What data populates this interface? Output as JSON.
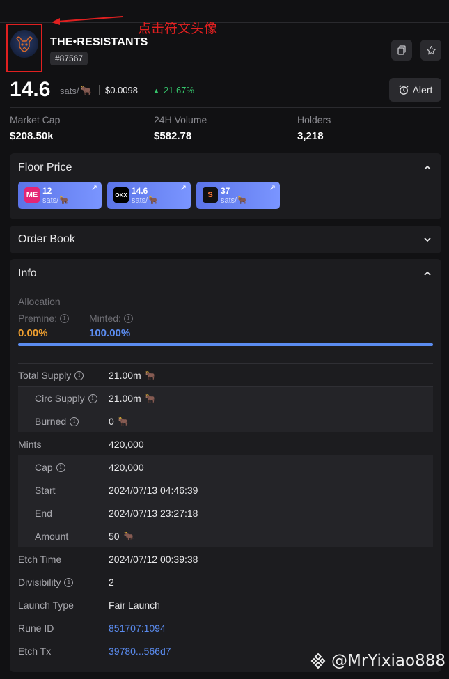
{
  "annotation": {
    "text": "点击符文头像"
  },
  "header": {
    "title": "THE•RESISTANTS",
    "rune_number": "#87567"
  },
  "price": {
    "value": "14.6",
    "unit": "sats/",
    "usd": "$0.0098",
    "change": "21.67%",
    "alert_label": "Alert"
  },
  "stats": [
    {
      "label": "Market Cap",
      "value": "$208.50k"
    },
    {
      "label": "24H Volume",
      "value": "$582.78"
    },
    {
      "label": "Holders",
      "value": "3,218"
    }
  ],
  "floor_price": {
    "title": "Floor Price",
    "markets": [
      {
        "value": "12",
        "unit": "sats/",
        "logo_text": "ME",
        "logo_color": "#e42575"
      },
      {
        "value": "14.6",
        "unit": "sats/",
        "logo_text": "OKX",
        "logo_color": "#000000"
      },
      {
        "value": "37",
        "unit": "sats/",
        "logo_text": "S",
        "logo_color": "#111111"
      }
    ]
  },
  "order_book": {
    "title": "Order Book"
  },
  "info": {
    "title": "Info",
    "allocation_label": "Allocation",
    "premine_label": "Premine:",
    "premine_value": "0.00%",
    "minted_label": "Minted:",
    "minted_value": "100.00%",
    "minted_fraction": 1.0,
    "rows": [
      {
        "key": "Total Supply",
        "value": "21.00m",
        "info": true,
        "rune_icon": true,
        "sub": false
      },
      {
        "key": "Circ Supply",
        "value": "21.00m",
        "info": true,
        "rune_icon": true,
        "sub": true
      },
      {
        "key": "Burned",
        "value": "0",
        "info": true,
        "rune_icon": true,
        "sub": true
      },
      {
        "key": "Mints",
        "value": "420,000",
        "info": false,
        "rune_icon": false,
        "sub": false
      },
      {
        "key": "Cap",
        "value": "420,000",
        "info": true,
        "rune_icon": false,
        "sub": true
      },
      {
        "key": "Start",
        "value": "2024/07/13 04:46:39",
        "info": false,
        "rune_icon": false,
        "sub": true
      },
      {
        "key": "End",
        "value": "2024/07/13 23:27:18",
        "info": false,
        "rune_icon": false,
        "sub": true
      },
      {
        "key": "Amount",
        "value": "50",
        "info": false,
        "rune_icon": true,
        "sub": true
      },
      {
        "key": "Etch Time",
        "value": "2024/07/12 00:39:38",
        "info": false,
        "rune_icon": false,
        "sub": false
      },
      {
        "key": "Divisibility",
        "value": "2",
        "info": true,
        "rune_icon": false,
        "sub": false
      },
      {
        "key": "Launch Type",
        "value": "Fair Launch",
        "info": false,
        "rune_icon": false,
        "sub": false
      },
      {
        "key": "Rune ID",
        "value": "851707:1094",
        "info": false,
        "rune_icon": false,
        "sub": false,
        "link": true
      },
      {
        "key": "Etch Tx",
        "value": "39780...566d7",
        "info": false,
        "rune_icon": false,
        "sub": false,
        "link": true
      }
    ]
  },
  "watermark": {
    "text": "@MrYixiao888"
  },
  "colors": {
    "accent": "#5b8cf0",
    "positive": "#35c46b",
    "premine": "#f0a030",
    "annotation": "#e02020"
  }
}
